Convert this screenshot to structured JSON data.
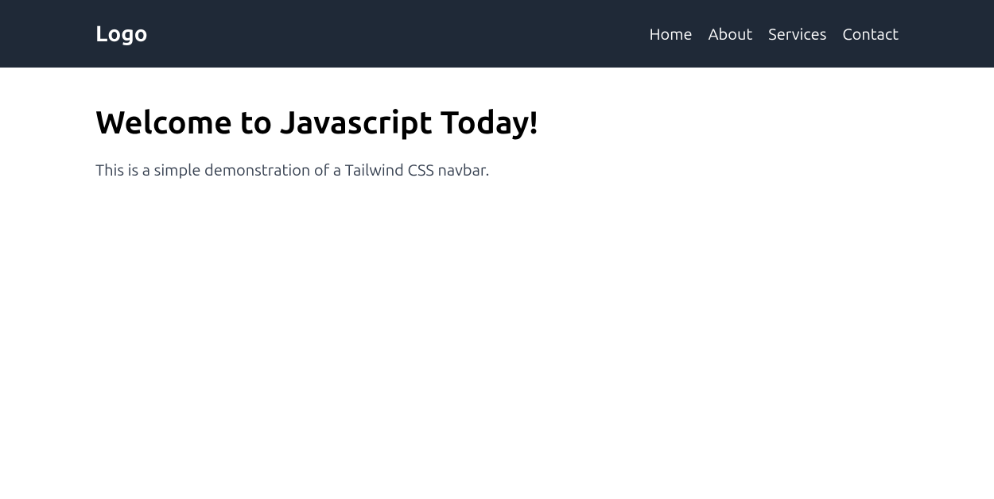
{
  "navbar": {
    "logo": "Logo",
    "links": [
      "Home",
      "About",
      "Services",
      "Contact"
    ]
  },
  "content": {
    "heading": "Welcome to Javascript Today!",
    "paragraph": "This is a simple demonstration of a Tailwind CSS navbar."
  }
}
